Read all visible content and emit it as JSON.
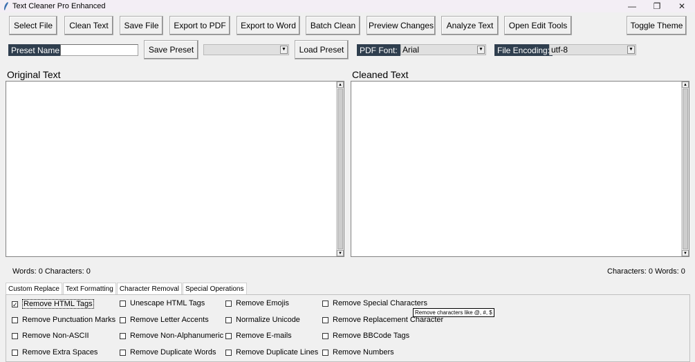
{
  "window": {
    "title": "Text Cleaner Pro Enhanced",
    "controls": {
      "minimize": "—",
      "restore": "❐",
      "close": "✕"
    }
  },
  "toolbar": {
    "select_file": "Select File",
    "clean_text": "Clean Text",
    "save_file": "Save File",
    "export_pdf": "Export to PDF",
    "export_word": "Export to Word",
    "batch_clean": "Batch Clean",
    "preview_changes": "Preview Changes",
    "analyze_text": "Analyze Text",
    "open_edit_tools": "Open Edit Tools",
    "toggle_theme": "Toggle Theme"
  },
  "preset": {
    "label": "Preset Name:",
    "name_value": "",
    "save_label": "Save Preset",
    "selected": "",
    "load_label": "Load Preset"
  },
  "pdf_font": {
    "label": "PDF Font:",
    "selected": "Arial"
  },
  "encoding": {
    "label": "File Encoding:",
    "selected": "utf-8"
  },
  "panes": {
    "original_title": "Original Text",
    "cleaned_title": "Cleaned Text",
    "original_count": "Words: 0  Characters: 0",
    "cleaned_count": "Characters: 0  Words: 0"
  },
  "tabs": [
    {
      "label": "Custom Replace"
    },
    {
      "label": "Text Formatting"
    },
    {
      "label": "Character Removal"
    },
    {
      "label": "Special Operations"
    }
  ],
  "options": {
    "col1": [
      {
        "label": "Remove HTML Tags",
        "checked": true
      },
      {
        "label": "Remove Punctuation Marks",
        "checked": false
      },
      {
        "label": "Remove Non-ASCII",
        "checked": false
      },
      {
        "label": "Remove Extra Spaces",
        "checked": false
      }
    ],
    "col2": [
      {
        "label": "Unescape HTML Tags",
        "checked": false
      },
      {
        "label": "Remove Letter Accents",
        "checked": false
      },
      {
        "label": "Remove Non-Alphanumeric",
        "checked": false
      },
      {
        "label": "Remove Duplicate Words",
        "checked": false
      }
    ],
    "col3": [
      {
        "label": "Remove Emojis",
        "checked": false
      },
      {
        "label": "Normalize Unicode",
        "checked": false
      },
      {
        "label": "Remove E-mails",
        "checked": false
      },
      {
        "label": "Remove Duplicate Lines",
        "checked": false
      }
    ],
    "col4": [
      {
        "label": "Remove Special Characters",
        "checked": false
      },
      {
        "label": "Remove Replacement Character",
        "checked": false
      },
      {
        "label": "Remove BBCode Tags",
        "checked": false
      },
      {
        "label": "Remove Numbers",
        "checked": false
      }
    ]
  },
  "tooltip": "Remove characters like @, #, $",
  "colors": {
    "dark_label_bg": "#2f3e4e",
    "window_bg": "#f0f0f0"
  }
}
